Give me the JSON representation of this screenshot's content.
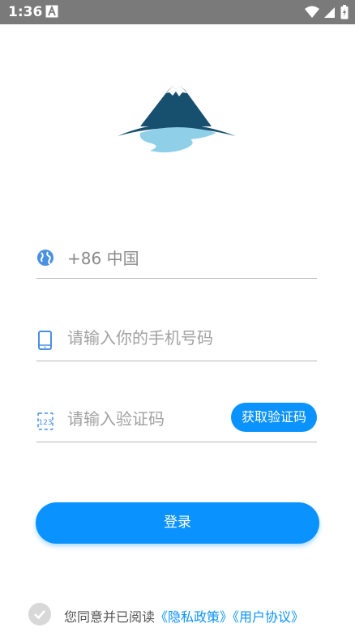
{
  "status_bar": {
    "time": "1:36",
    "notification_icon": "a-badge-icon",
    "wifi_icon": "wifi-icon",
    "signal_icon": "signal-icon",
    "battery_icon": "battery-icon"
  },
  "logo": {
    "icon": "mountain-lake-logo",
    "colors": {
      "mountain": "#17506f",
      "snow": "#ffffff",
      "water": "#8fcfe8"
    }
  },
  "form": {
    "country": {
      "icon": "globe-icon",
      "value": "+86 中国"
    },
    "phone": {
      "icon": "phone-icon",
      "placeholder": "请输入你的手机号码"
    },
    "code": {
      "icon": "code-123-icon",
      "placeholder": "请输入验证码",
      "button": "获取验证码"
    }
  },
  "login_button": "登录",
  "agreement": {
    "prefix": "您同意并已阅读",
    "privacy": "《隐私政策》",
    "terms": "《用户协议》"
  },
  "colors": {
    "accent": "#0a92ff",
    "icon": "#4a90e2",
    "status_bar": "#7a7a7a"
  }
}
